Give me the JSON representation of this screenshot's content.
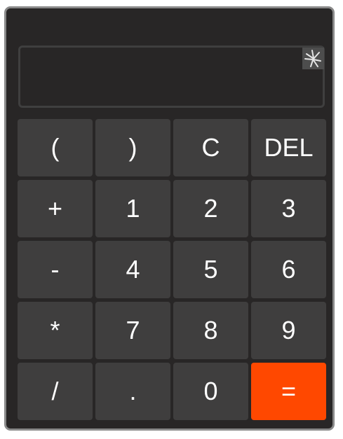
{
  "display": {
    "value": ""
  },
  "keys": [
    "(",
    ")",
    "C",
    "DEL",
    "+",
    "1",
    "2",
    "3",
    "-",
    "4",
    "5",
    "6",
    "*",
    "7",
    "8",
    "9",
    "/",
    ".",
    "0",
    "="
  ],
  "colors": {
    "body": "#282626",
    "border": "#8a8a8a",
    "key": "#3f3e3e",
    "equals": "#ff4800",
    "text": "#ffffff"
  },
  "icons": {
    "display_corner": "broken-image-icon"
  }
}
